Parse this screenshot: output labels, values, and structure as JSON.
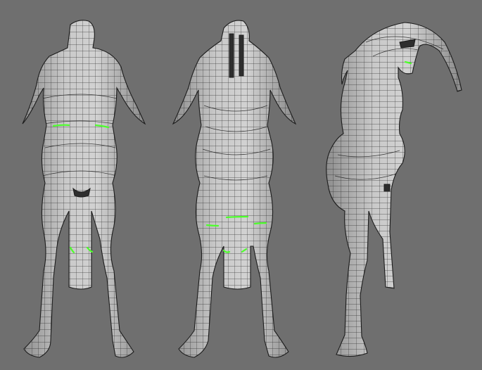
{
  "viewport": {
    "background": "#6f6f6f",
    "mesh_color": "#202020",
    "surface_color": "#bdbdbd",
    "selection_color": "#4cff2a",
    "views": [
      "back",
      "front",
      "side"
    ]
  }
}
